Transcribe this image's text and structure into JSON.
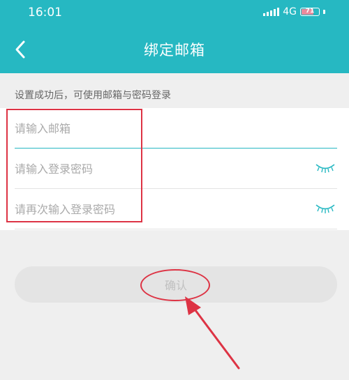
{
  "status_bar": {
    "time": "16:01",
    "network": "4G",
    "battery": "71"
  },
  "nav": {
    "back_icon": "chevron-left-icon",
    "title": "绑定邮箱"
  },
  "hint": "设置成功后，可使用邮箱与密码登录",
  "form": {
    "email_placeholder": "请输入邮箱",
    "password_placeholder": "请输入登录密码",
    "confirm_password_placeholder": "请再次输入登录密码",
    "eye_icon": "eye-closed-icon"
  },
  "confirm_label": "确认",
  "colors": {
    "brand": "#26b8c2",
    "annotation": "#dd3344"
  }
}
